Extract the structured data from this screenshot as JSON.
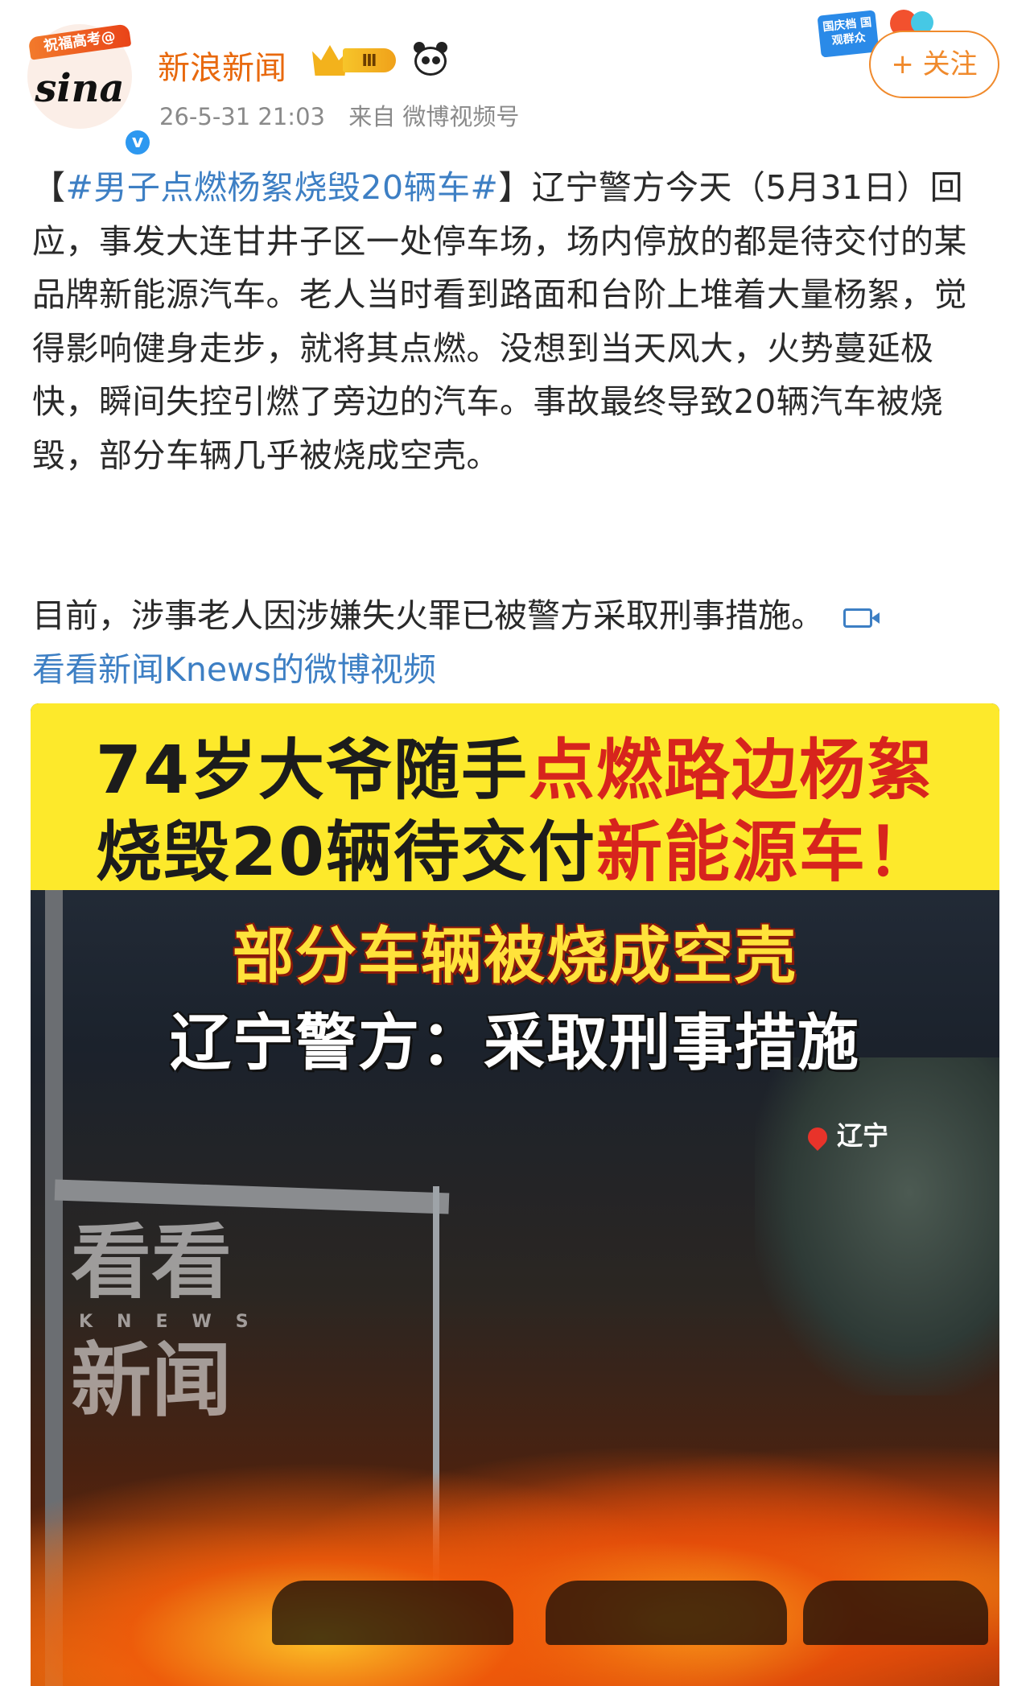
{
  "header": {
    "avatar_tag": "祝福高考@",
    "avatar_logo": "sina",
    "verify": "v",
    "username": "新浪新闻",
    "vip_level": "Ⅲ",
    "date": "26-5-31 21:03",
    "source": "来自 微博视频号",
    "event_badge": "国庆档 国观群众",
    "follow_label": "+ 关注"
  },
  "post": {
    "open_bracket": "【",
    "topic": "#男子点燃杨絮烧毁20辆车#",
    "body": "】辽宁警方今天（5月31日）回应，事发大连甘井子区一处停车场，场内停放的都是待交付的某品牌新能源汽车。老人当时看到路面和台阶上堆着大量杨絮，觉得影响健身走步，就将其点燃。没想到当天风大，火势蔓延极快，瞬间失控引燃了旁边的汽车。事故最终导致20辆汽车被烧毁，部分车辆几乎被烧成空壳。",
    "body2": "目前，涉事老人因涉嫌失火罪已被警方采取刑事措施。",
    "video_link": "看看新闻Knews的微博视频"
  },
  "video": {
    "headline1_black": "74岁大爷随手",
    "headline1_red": "点燃路边杨絮",
    "headline2_black": "烧毁20辆待交付",
    "headline2_red": "新能源车！",
    "sub1": "部分车辆被烧成空壳",
    "sub2": "辽宁警方：采取刑事措施",
    "location": "辽宁",
    "watermark_top": "看看",
    "watermark_k": "KNEWS",
    "watermark_bottom": "新闻"
  },
  "colors": {
    "username": "#e8690e",
    "topic_link": "#3d7fc4",
    "follow": "#f08a2c",
    "headline_band": "#fde92b",
    "headline_red": "#d7241d"
  },
  "icons": [
    "verified-icon",
    "vip-crown-icon",
    "panda-icon",
    "video-icon",
    "location-pin-icon"
  ]
}
